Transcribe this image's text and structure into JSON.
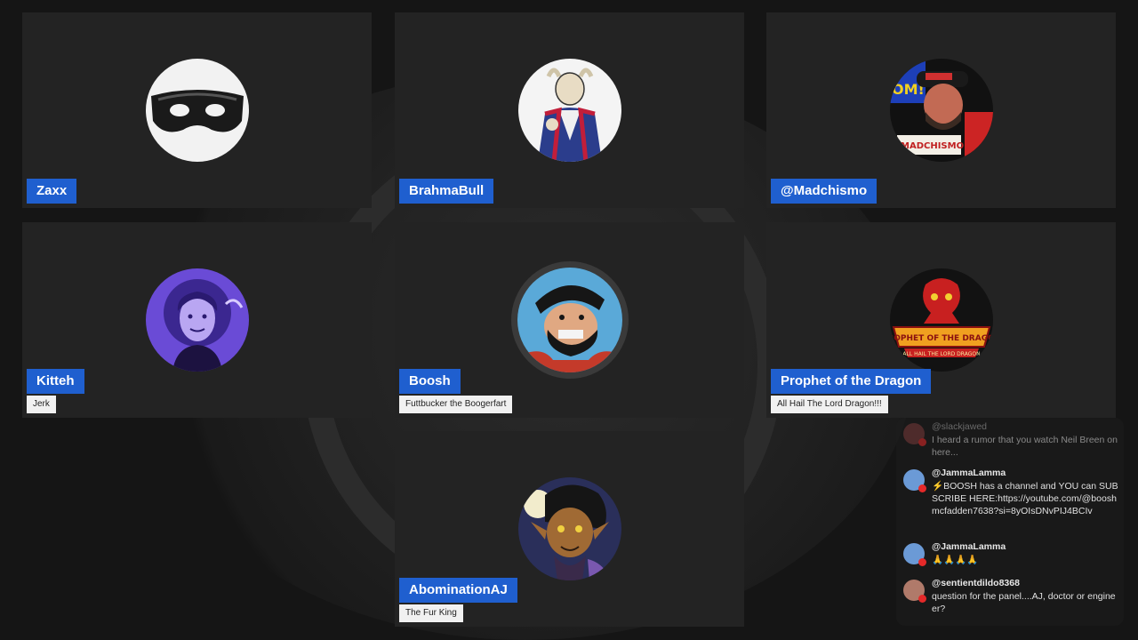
{
  "participants": [
    {
      "name": "Zaxx",
      "subtitle": null,
      "avatar": "black-mask-avatar"
    },
    {
      "name": "BrahmaBull",
      "subtitle": null,
      "avatar": "bull-in-robe-avatar"
    },
    {
      "name": "@Madchismo",
      "subtitle": null,
      "avatar": "madchismo-photo-avatar",
      "avatar_text": "MADCHISMO"
    },
    {
      "name": "Kitteh",
      "subtitle": "Jerk",
      "avatar": "purple-portrait-avatar"
    },
    {
      "name": "Boosh",
      "subtitle": "Futtbucker the Boogerfart",
      "avatar": "cartoon-sailor-avatar"
    },
    {
      "name": "Prophet of the Dragon",
      "subtitle": "All Hail The Lord Dragon!!!",
      "avatar": "red-dragon-logo-avatar",
      "avatar_text_1": "PROPHET OF THE DRAGON",
      "avatar_text_2": "ALL HAIL THE LORD DRAGON"
    },
    {
      "name": "AbominationAJ",
      "subtitle": "The Fur King",
      "avatar": "cartoon-satyr-avatar"
    }
  ],
  "chat": [
    {
      "handle": "@slackjawed",
      "text": "I heard a rumor that you watch Neil Breen on here..."
    },
    {
      "handle": "@JammaLamma",
      "text": "⚡BOOSH has a channel and YOU can SUBSCRIBE HERE:https://youtube.com/@booshmcfadden7638?si=8yOIsDNvPIJ4BCIv"
    },
    {
      "handle": "@JammaLamma",
      "text": "🙏🙏🙏🙏"
    },
    {
      "handle": "@sentientdildo8368",
      "text": "question for the panel....AJ, doctor or engineer?"
    }
  ],
  "colors": {
    "name_badge": "#1f5fcf",
    "tile_bg": "#232323",
    "live_dot": "#e52929"
  }
}
